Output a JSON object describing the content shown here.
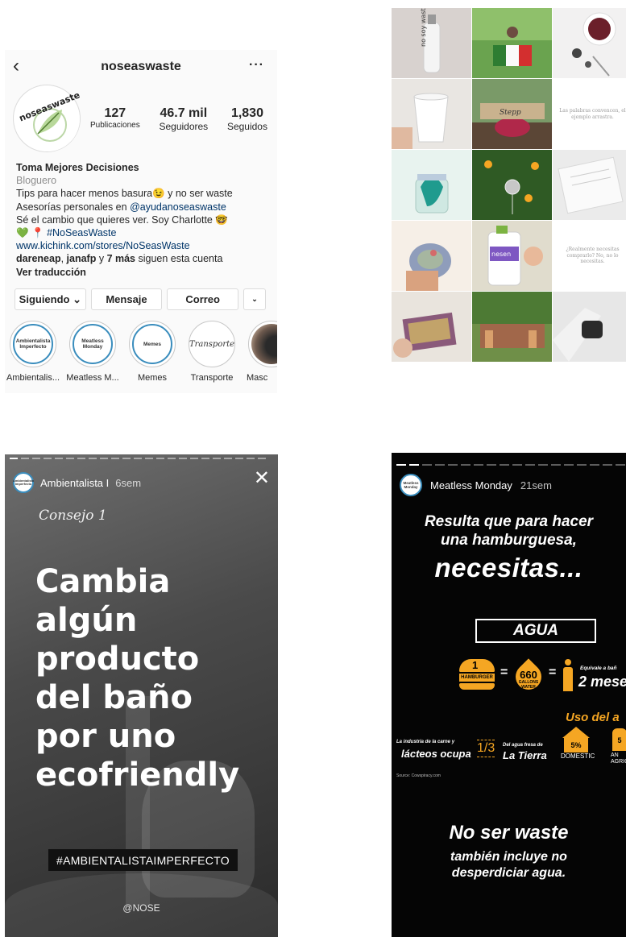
{
  "profile": {
    "username": "noseaswaste",
    "back_icon": "‹",
    "more_icon": "···",
    "avatar_text": "noseaswaste",
    "stats": [
      {
        "value": "127",
        "label": "Publicaciones"
      },
      {
        "value": "46.7 mil",
        "label": "Seguidores"
      },
      {
        "value": "1,830",
        "label": "Seguidos"
      }
    ],
    "bio": {
      "name": "Toma Mejores Decisiones",
      "category": "Bloguero",
      "line1": "Tips para hacer menos basura😉 y no ser waste",
      "line2_prefix": "Asesorías personales en ",
      "line2_mention": "@ayudanoseaswaste",
      "line3": "Sé el cambio que quieres ver. Soy Charlotte 🤓",
      "line4_emoji": "💚 📍 ",
      "line4_tag": "#NoSeasWaste",
      "website": "www.kichink.com/stores/NoSeasWaste",
      "followed_bold": "dareneap",
      "followed_mid": ", ",
      "followed_bold2": "janafp",
      "followed_mid2": " y ",
      "followed_bold3": "7 más",
      "followed_suffix": " siguen esta cuenta",
      "translate": "Ver traducción"
    },
    "buttons": {
      "following": "Siguiendo ⌄",
      "message": "Mensaje",
      "email": "Correo",
      "dropdown": "⌄"
    },
    "highlights": [
      {
        "label": "Ambientalis...",
        "inner": "Ambientalista Imperfecto"
      },
      {
        "label": "Meatless M...",
        "inner": "Meatless Monday"
      },
      {
        "label": "Memes",
        "inner": "Memes"
      },
      {
        "label": "Transporte",
        "inner": "Transporte"
      },
      {
        "label": "Masc",
        "inner": ""
      }
    ]
  },
  "grid": {
    "quotes": {
      "q1": "Las palabras convencen, el ejemplo arrastra.",
      "q2": "¿Realmente necesitas comprarlo? No, no lo necesitas."
    },
    "cell_colors": [
      [
        "#d8d2cf",
        "#6aa34f",
        "#f2f1f1"
      ],
      [
        "#e9e6e2",
        "#7a9a68",
        "#ffffff"
      ],
      [
        "#e8f3ef",
        "#2f5a24",
        "#ebebeb"
      ],
      [
        "#f6efe7",
        "#e0dccd",
        "#ffffff"
      ],
      [
        "#8d6e63",
        "#6f8f48",
        "#d9d9d9"
      ]
    ]
  },
  "story1": {
    "account": "Ambientalista I",
    "time": "6sem",
    "close_icon": "✕",
    "mini_avatar": "Ambientalista Imperfecto",
    "heading": "Consejo 1",
    "big_line1": "Cambia",
    "big_line2": "algún",
    "big_line3": "producto",
    "big_line4": "del baño",
    "big_line5": "por uno",
    "big_line6": "ecofriendly",
    "hashtag": "#AMBIENTALISTAIMPERFECTO",
    "handle": "@NOSE"
  },
  "story2": {
    "account": "Meatless Monday",
    "time": "21sem",
    "mini_avatar": "Meatless Monday",
    "line1": "Resulta que para hacer",
    "line2": "una hamburguesa,",
    "line3": "necesitas...",
    "agua": "AGUA",
    "burger_num": "1",
    "burger_label": "HAMBURGER",
    "gallons": "660",
    "gallons_unit": "GALLONS WATER",
    "equiv": "Equivale a bañ",
    "meses": "2 mese",
    "uso": "Uso del a",
    "industry_small": "La industria de la carne y",
    "industry_big": "lácteos ocupa",
    "fraction": "1/3",
    "tierra_small": "Del agua fresa de",
    "tierra_big": "La Tierra",
    "pct1": "5%",
    "domestic": "DOMESTIC",
    "pct2": "5",
    "agric": "AN AGRIC",
    "source": "Source: Cowspiracy.com",
    "closing1": "No ser waste",
    "closing2": "también incluye no",
    "closing3": "desperdiciar agua."
  }
}
